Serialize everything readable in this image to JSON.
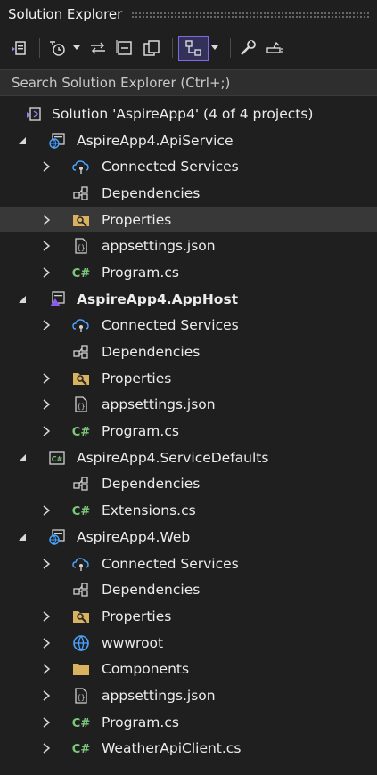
{
  "panel": {
    "title": "Solution Explorer"
  },
  "toolbar": {
    "buttons": [
      {
        "name": "switch-views-icon"
      },
      {
        "name": "pending-changes-filter-icon"
      },
      {
        "name": "sync-with-active-document-icon"
      },
      {
        "name": "collapse-all-icon"
      },
      {
        "name": "show-all-files-icon"
      },
      {
        "name": "preview-selected-items-icon"
      },
      {
        "name": "properties-icon"
      },
      {
        "name": "more-options-icon"
      }
    ]
  },
  "search": {
    "placeholder": "Search Solution Explorer (Ctrl+;)"
  },
  "tree": {
    "solution": "Solution 'AspireApp4' (4 of 4 projects)",
    "projects": [
      {
        "label": "AspireApp4.ApiService",
        "bold": false,
        "icon": "web-project-icon",
        "children": [
          {
            "label": "Connected Services",
            "icon": "connected-services-icon",
            "expandable": true
          },
          {
            "label": "Dependencies",
            "icon": "dependencies-icon",
            "expandable": false
          },
          {
            "label": "Properties",
            "icon": "properties-folder-icon",
            "expandable": true,
            "selected": true
          },
          {
            "label": "appsettings.json",
            "icon": "json-file-icon",
            "expandable": true
          },
          {
            "label": "Program.cs",
            "icon": "csharp-file-icon",
            "expandable": true
          }
        ]
      },
      {
        "label": "AspireApp4.AppHost",
        "bold": true,
        "icon": "apphost-project-icon",
        "children": [
          {
            "label": "Connected Services",
            "icon": "connected-services-icon",
            "expandable": true
          },
          {
            "label": "Dependencies",
            "icon": "dependencies-icon",
            "expandable": false
          },
          {
            "label": "Properties",
            "icon": "properties-folder-icon",
            "expandable": true
          },
          {
            "label": "appsettings.json",
            "icon": "json-file-icon",
            "expandable": true
          },
          {
            "label": "Program.cs",
            "icon": "csharp-file-icon",
            "expandable": true
          }
        ]
      },
      {
        "label": "AspireApp4.ServiceDefaults",
        "bold": false,
        "icon": "csharp-project-icon",
        "children": [
          {
            "label": "Dependencies",
            "icon": "dependencies-icon",
            "expandable": false
          },
          {
            "label": "Extensions.cs",
            "icon": "csharp-file-icon",
            "expandable": true
          }
        ]
      },
      {
        "label": "AspireApp4.Web",
        "bold": false,
        "icon": "web-project-icon",
        "children": [
          {
            "label": "Connected Services",
            "icon": "connected-services-icon",
            "expandable": true
          },
          {
            "label": "Dependencies",
            "icon": "dependencies-icon",
            "expandable": false
          },
          {
            "label": "Properties",
            "icon": "properties-folder-icon",
            "expandable": true
          },
          {
            "label": "wwwroot",
            "icon": "globe-icon",
            "expandable": true
          },
          {
            "label": "Components",
            "icon": "folder-icon",
            "expandable": true
          },
          {
            "label": "appsettings.json",
            "icon": "json-file-icon",
            "expandable": true
          },
          {
            "label": "Program.cs",
            "icon": "csharp-file-icon",
            "expandable": true
          },
          {
            "label": "WeatherApiClient.cs",
            "icon": "csharp-file-icon",
            "expandable": true
          }
        ]
      }
    ]
  },
  "colors": {
    "background": "#1f1f1f",
    "accent": "#8b7be8",
    "csharp": "#7cc97c",
    "selection": "#383838"
  }
}
